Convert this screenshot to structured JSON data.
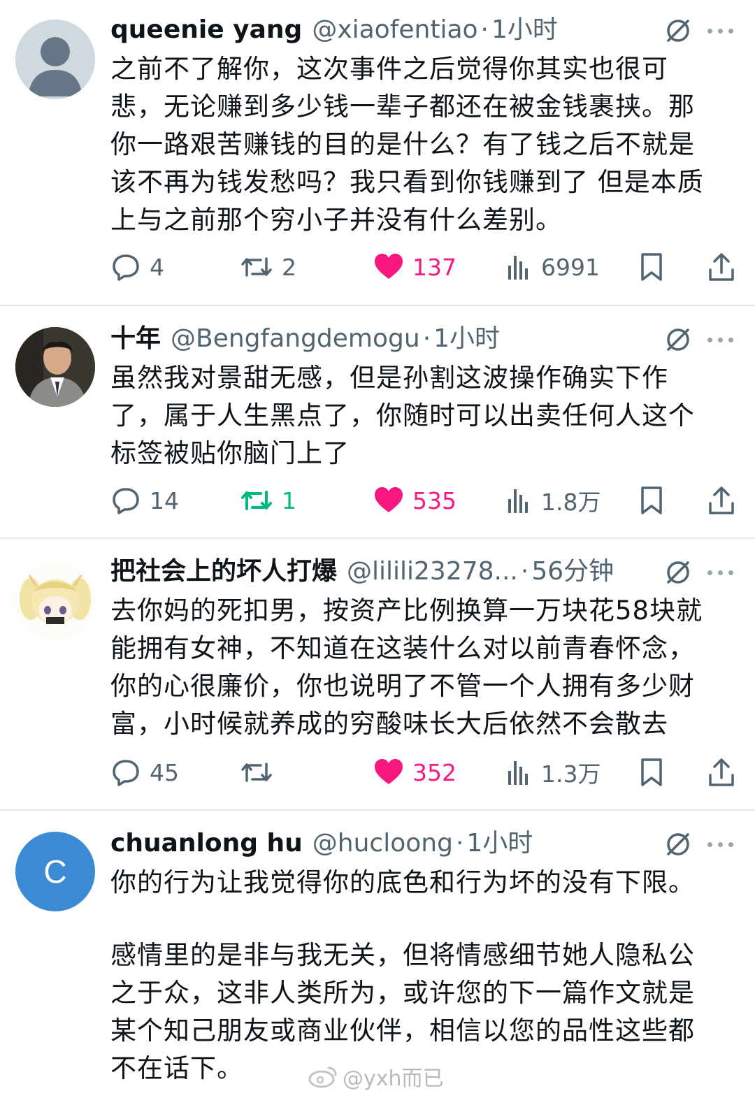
{
  "tweets": [
    {
      "name": "queenie yang",
      "handle": "@xiaofentiao",
      "dot": "·",
      "time": "1小时",
      "avatar": "default-avatar",
      "text": [
        "之前不了解你，这次事件之后觉得你其实也很可",
        "悲，无论赚到多少钱一辈子都还在被金钱裹挟。那",
        "你一路艰苦赚钱的目的是什么？有了钱之后不就是",
        "该不再为钱发愁吗？我只看到你钱赚到了 但是本质",
        "上与之前那个穷小子并没有什么差别。"
      ],
      "replies": "4",
      "retweets": "2",
      "likes": "137",
      "views": "6991"
    },
    {
      "name": "十年",
      "handle": "@Bengfangdemogu",
      "dot": "·",
      "time": "1小时",
      "avatar": "photo-avatar",
      "text": [
        "虽然我对景甜无感，但是孙割这波操作确实下作",
        "了，属于人生黑点了，你随时可以出卖任何人这个",
        "标签被贴你脑门上了"
      ],
      "replies": "14",
      "retweets": "1",
      "likes": "535",
      "views": "1.8万"
    },
    {
      "name": "把社会上的坏人打爆",
      "handle": "@lilili23278...",
      "dot": "·",
      "time": "56分钟",
      "avatar": "anime-avatar",
      "text": [
        "去你妈的死扣男，按资产比例换算一万块花58块就",
        "能拥有女神，不知道在这装什么对以前青春怀念，",
        "你的心很廉价，你也说明了不管一个人拥有多少财",
        "富，小时候就养成的穷酸味长大后依然不会散去"
      ],
      "replies": "45",
      "retweets": "",
      "likes": "352",
      "views": "1.3万"
    },
    {
      "name": "chuanlong hu",
      "handle": "@hucloong",
      "dot": "·",
      "time": "1小时",
      "avatar": "letter-avatar",
      "avatar_letter": "C",
      "text": [
        "你的行为让我觉得你的底色和行为坏的没有下限。",
        "",
        "感情里的是非与我无关，但将情感细节她人隐私公",
        "之于众，这非人类所为，或许您的下一篇作文就是",
        "某个知己朋友或商业伙伴，相信以您的品性这些都",
        "不在话下。"
      ]
    }
  ],
  "watermark": "@yxh而已",
  "colors": {
    "like": "#f91880",
    "retweet_active": "#00ba7c",
    "muted": "#536471",
    "letter_avatar": "#3a8ad4"
  }
}
